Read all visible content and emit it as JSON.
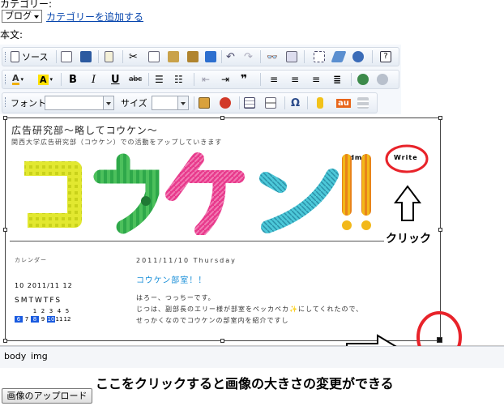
{
  "form": {
    "category_label": "カテゴリー:",
    "category_selected": "ブログ",
    "add_category_link": "カテゴリーを追加する",
    "body_label": "本文:"
  },
  "toolbar": {
    "source_label": "ソース",
    "font_label": "フォント",
    "size_label": "サイズ",
    "font_value": "",
    "size_value": "",
    "bold": "B",
    "italic": "I",
    "underline": "U",
    "strike": "abc",
    "quote": "❞",
    "omega": "Ω",
    "au": "au"
  },
  "blog": {
    "title": "広告研究部〜略してコウケン〜",
    "subtitle": "関西大学広告研究部（コウケン）での活動をアップしていきます",
    "nav_admin": "Admin",
    "nav_write": "Write",
    "calendar_label": "カレンダー",
    "calendar_month": "10  2011/11  12",
    "calendar_days": "SMTWTFS",
    "calendar_rows": [
      [
        "",
        "",
        "1",
        "2",
        "3",
        "4",
        "5"
      ],
      [
        "6",
        "7",
        "8",
        "9",
        "10",
        "11",
        "12"
      ]
    ],
    "post_date": "2011/11/10 Thursday",
    "post_title": "コウケン部室！！",
    "post_line1": "はろー、つっちーです。",
    "post_line2": "じつは、副部長のエリー様が部室をペッカペカ✨にしてくれたので、",
    "post_line3": "せっかくなのでコウケンの部室内を紹介ですし"
  },
  "statusbar": {
    "path_body": "body",
    "path_img": "img"
  },
  "upload_button": "画像のアップロード",
  "annotations": {
    "click_label": "クリック",
    "caption": "ここをクリックすると画像の大きさの変更ができる"
  },
  "colors": {
    "annotation_red": "#e8232a",
    "link": "#0645ad",
    "calendar_highlight": "#1a5be0",
    "post_title": "#1a8fd8"
  }
}
